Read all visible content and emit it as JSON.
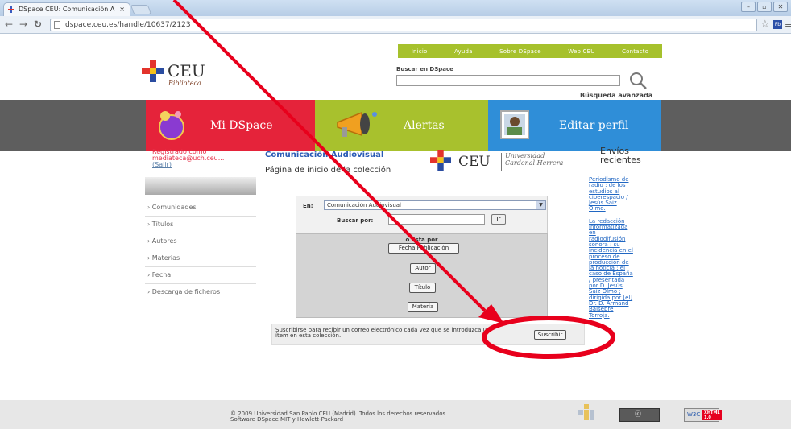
{
  "browser": {
    "tab_title": "DSpace CEU: Comunicación A",
    "tab_close": "×",
    "url": "dspace.ceu.es/handle/10637/2123",
    "ext_label": "Fb"
  },
  "topnav": [
    "Inicio",
    "Ayuda",
    "Sobre DSpace",
    "Web CEU",
    "Contacto"
  ],
  "logo": {
    "name": "CEU",
    "sub": "Biblioteca"
  },
  "search": {
    "label": "Buscar en DSpace",
    "advanced": "Búsqueda avanzada"
  },
  "tiles": [
    "Mi DSpace",
    "Alertas",
    "Editar perfil"
  ],
  "user": {
    "line1": "Registrado como",
    "line2": "mediateca@uch.ceu...",
    "salir": "(Salir)"
  },
  "left_nav": [
    "Comunidades",
    "Títulos",
    "Autores",
    "Materias",
    "Fecha",
    "Descarga de ficheros"
  ],
  "collection": {
    "title": "Comunicación Audiovisual",
    "subtitle": "Página de inicio de la colección"
  },
  "univ": {
    "ceu": "CEU",
    "line1": "Universidad",
    "line2": "Cardenal Herrera"
  },
  "in_search": {
    "en_label": "En:",
    "en_value": "Comunicación Audiovisual",
    "buscar_label": "Buscar por:",
    "go": "Ir"
  },
  "browse": {
    "label": "o lista por",
    "buttons": [
      "Fecha Publicación",
      "Autor",
      "Título",
      "Materia"
    ]
  },
  "subscribe": {
    "text": "Suscribirse para recibir un correo electrónico cada vez que se introduzca un ítem en esta colección.",
    "button": "Suscribir"
  },
  "recent": {
    "title_line1": "Envíos",
    "title_line2": "recientes",
    "items": [
      "Periodismo de radio : de los estudios al ciberespacio / Jesús Saiz Olmo.",
      "La redacción informatizada en radiodifusión sonora : su incidencia en el proceso de producción de la noticia : el caso de España / presentada por D. Jesús Saiz Olmo ; dirigida por [el] Dr. D. Armand Balsebre Torroja."
    ]
  },
  "footer": {
    "line1": "© 2009 Universidad San Pablo CEU (Madrid). Todos los derechos reservados.",
    "line2": "Software DSpace MIT y Hewlett-Packard",
    "w3c": "W3C",
    "xhtml": "XHTML 1.0"
  },
  "colors": {
    "green": "#a6c12c",
    "red": "#e5233a",
    "blue": "#2f8ed8",
    "annotation": "#e8001c"
  }
}
